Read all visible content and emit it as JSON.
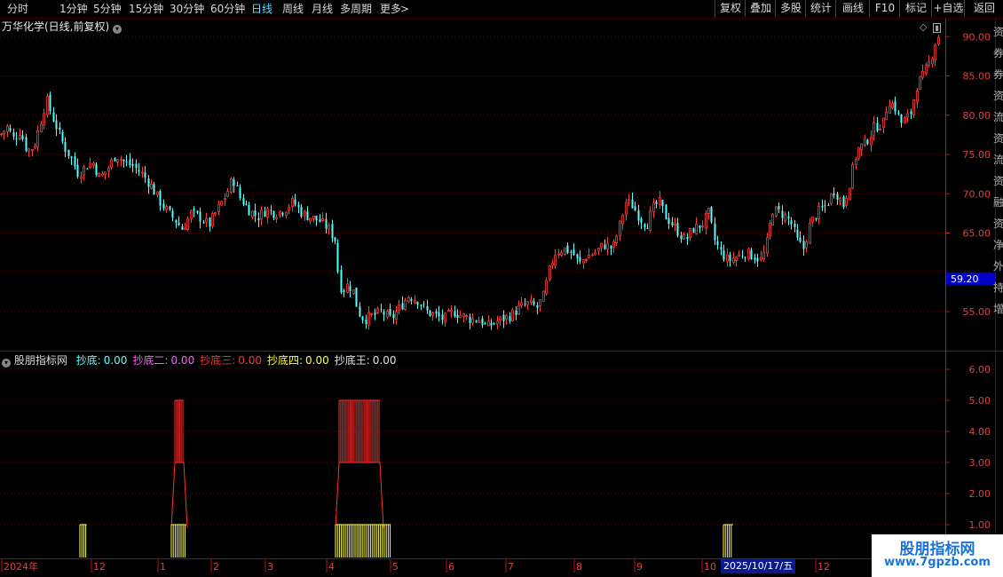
{
  "toolbar": {
    "periods": [
      "分时",
      "1分钟",
      "5分钟",
      "15分钟",
      "30分钟",
      "60分钟",
      "日线",
      "周线",
      "月线",
      "多周期",
      "更多"
    ],
    "active_period": "日线",
    "more_arrow": ">",
    "right_buttons": [
      "复权",
      "叠加",
      "多股",
      "统计",
      "画线",
      "F10",
      "标记",
      "+自选",
      "返回"
    ]
  },
  "main_chart": {
    "title": "万华化学(日线,前复权)",
    "price_labels": [
      "90.00",
      "85.00",
      "80.00",
      "75.00",
      "70.00",
      "65.00",
      "55.00"
    ],
    "current_price": "59.20",
    "colors": {
      "up": "#ff3b3b",
      "down": "#54ffff",
      "grid": "#6a0000",
      "axis": "#c01010",
      "price_box": "#0000c8"
    }
  },
  "indicator": {
    "name": "股朋指标网",
    "series": [
      {
        "name": "抄底:",
        "value": "0.00",
        "color": "#5fffff"
      },
      {
        "name": "抄底二:",
        "value": "0.00",
        "color": "#ff5fff"
      },
      {
        "name": "抄底三:",
        "value": "0.00",
        "color": "#ff3030"
      },
      {
        "name": "抄底四:",
        "value": "0.00",
        "color": "#ffff40"
      },
      {
        "name": "抄底王:",
        "value": "0.00",
        "color": "#e0e0e0"
      }
    ],
    "y_labels": [
      "6.00",
      "5.00",
      "4.00",
      "3.00",
      "2.00",
      "1.00"
    ]
  },
  "time_axis": {
    "labels": [
      "2024年",
      "12",
      "1",
      "2",
      "3",
      "4",
      "5",
      "6",
      "7",
      "8",
      "9",
      "10",
      "12"
    ],
    "cursor_date": "2025/10/17/五"
  },
  "right_panel_text": [
    "资",
    "券",
    "券",
    "资",
    "流",
    "资",
    "流",
    "资",
    "融",
    "资",
    "净",
    "外",
    "持",
    "增"
  ],
  "watermark": {
    "title": "股朋指标网",
    "url": "www.7gpzb.com"
  },
  "chart_data": {
    "type": "candlestick",
    "price_axis_range": [
      50,
      92
    ],
    "price_ticks": [
      55,
      65,
      70,
      75,
      80,
      85,
      90
    ],
    "current_price": 59.2,
    "close_path": [
      [
        0,
        77.5
      ],
      [
        8,
        78.5
      ],
      [
        15,
        77
      ],
      [
        22,
        78
      ],
      [
        30,
        75.5
      ],
      [
        38,
        76
      ],
      [
        45,
        79
      ],
      [
        52,
        82
      ],
      [
        58,
        80
      ],
      [
        65,
        78
      ],
      [
        72,
        76
      ],
      [
        80,
        74.5
      ],
      [
        88,
        72.5
      ],
      [
        96,
        73.5
      ],
      [
        104,
        74
      ],
      [
        112,
        72
      ],
      [
        120,
        73
      ],
      [
        130,
        75
      ],
      [
        140,
        74
      ],
      [
        150,
        73.5
      ],
      [
        160,
        72.5
      ],
      [
        170,
        71
      ],
      [
        180,
        69
      ],
      [
        190,
        67.5
      ],
      [
        198,
        66.5
      ],
      [
        205,
        65.5
      ],
      [
        215,
        67.5
      ],
      [
        225,
        67
      ],
      [
        235,
        66
      ],
      [
        245,
        68
      ],
      [
        255,
        70
      ],
      [
        262,
        72
      ],
      [
        270,
        69.5
      ],
      [
        280,
        68
      ],
      [
        290,
        67
      ],
      [
        300,
        68
      ],
      [
        310,
        67.5
      ],
      [
        320,
        68
      ],
      [
        330,
        69
      ],
      [
        340,
        67.5
      ],
      [
        350,
        67
      ],
      [
        360,
        66.5
      ],
      [
        370,
        65.5
      ],
      [
        378,
        64
      ],
      [
        380,
        60.5
      ],
      [
        385,
        57.5
      ],
      [
        392,
        58.5
      ],
      [
        398,
        57.5
      ],
      [
        403,
        55
      ],
      [
        410,
        54
      ],
      [
        420,
        54.5
      ],
      [
        430,
        55
      ],
      [
        440,
        54
      ],
      [
        450,
        55.5
      ],
      [
        460,
        57
      ],
      [
        470,
        56.5
      ],
      [
        480,
        55
      ],
      [
        490,
        54.5
      ],
      [
        500,
        54
      ],
      [
        510,
        55
      ],
      [
        520,
        54.5
      ],
      [
        530,
        54
      ],
      [
        540,
        54
      ],
      [
        548,
        53
      ],
      [
        555,
        53.5
      ],
      [
        565,
        54
      ],
      [
        575,
        54.5
      ],
      [
        585,
        55.5
      ],
      [
        595,
        56
      ],
      [
        605,
        55.5
      ],
      [
        612,
        57
      ],
      [
        618,
        60
      ],
      [
        625,
        62.5
      ],
      [
        635,
        63
      ],
      [
        645,
        62.5
      ],
      [
        652,
        61
      ],
      [
        660,
        62
      ],
      [
        670,
        62.5
      ],
      [
        680,
        63.5
      ],
      [
        690,
        63
      ],
      [
        698,
        66
      ],
      [
        705,
        69
      ],
      [
        712,
        68.5
      ],
      [
        720,
        67
      ],
      [
        728,
        66
      ],
      [
        735,
        68
      ],
      [
        742,
        69
      ],
      [
        750,
        67
      ],
      [
        758,
        66
      ],
      [
        765,
        65
      ],
      [
        772,
        64
      ],
      [
        780,
        65.5
      ],
      [
        790,
        66
      ],
      [
        798,
        67.5
      ],
      [
        805,
        64
      ],
      [
        812,
        62.5
      ],
      [
        820,
        61.5
      ],
      [
        830,
        62
      ],
      [
        840,
        62.5
      ],
      [
        850,
        62
      ],
      [
        858,
        61.5
      ],
      [
        864,
        64
      ],
      [
        870,
        68
      ],
      [
        880,
        67.5
      ],
      [
        890,
        66.5
      ],
      [
        898,
        64
      ],
      [
        905,
        63
      ],
      [
        912,
        66
      ],
      [
        920,
        67.5
      ],
      [
        930,
        68.5
      ],
      [
        940,
        70.5
      ],
      [
        950,
        68.5
      ],
      [
        958,
        72
      ],
      [
        965,
        75.5
      ],
      [
        975,
        76.5
      ],
      [
        985,
        78.5
      ],
      [
        995,
        79
      ],
      [
        1000,
        82
      ],
      [
        1008,
        81
      ],
      [
        1015,
        79
      ],
      [
        1025,
        80
      ],
      [
        1033,
        84
      ],
      [
        1040,
        85
      ],
      [
        1048,
        87
      ],
      [
        1055,
        90
      ]
    ],
    "signal_bars": [
      {
        "series": "抄底三",
        "x_range": [
          197,
          207
        ],
        "top": 5,
        "mid": 3,
        "color": "#ff3030"
      },
      {
        "series": "抄底三",
        "x_range": [
          382,
          428
        ],
        "top": 5,
        "mid": 3,
        "color": "#ff3030"
      },
      {
        "series": "抄底四",
        "x_range": [
          90,
          98
        ],
        "value": 1,
        "color": "#ffff40"
      },
      {
        "series": "抄底四",
        "x_range": [
          193,
          210
        ],
        "value": 1,
        "color": "#ffff40"
      },
      {
        "series": "抄底四",
        "x_range": [
          378,
          440
        ],
        "value": 1,
        "color": "#ffff40"
      },
      {
        "series": "抄底四",
        "x_range": [
          815,
          826
        ],
        "value": 1,
        "color": "#ffff40"
      }
    ],
    "indicator_axis_range": [
      0,
      6.5
    ]
  }
}
